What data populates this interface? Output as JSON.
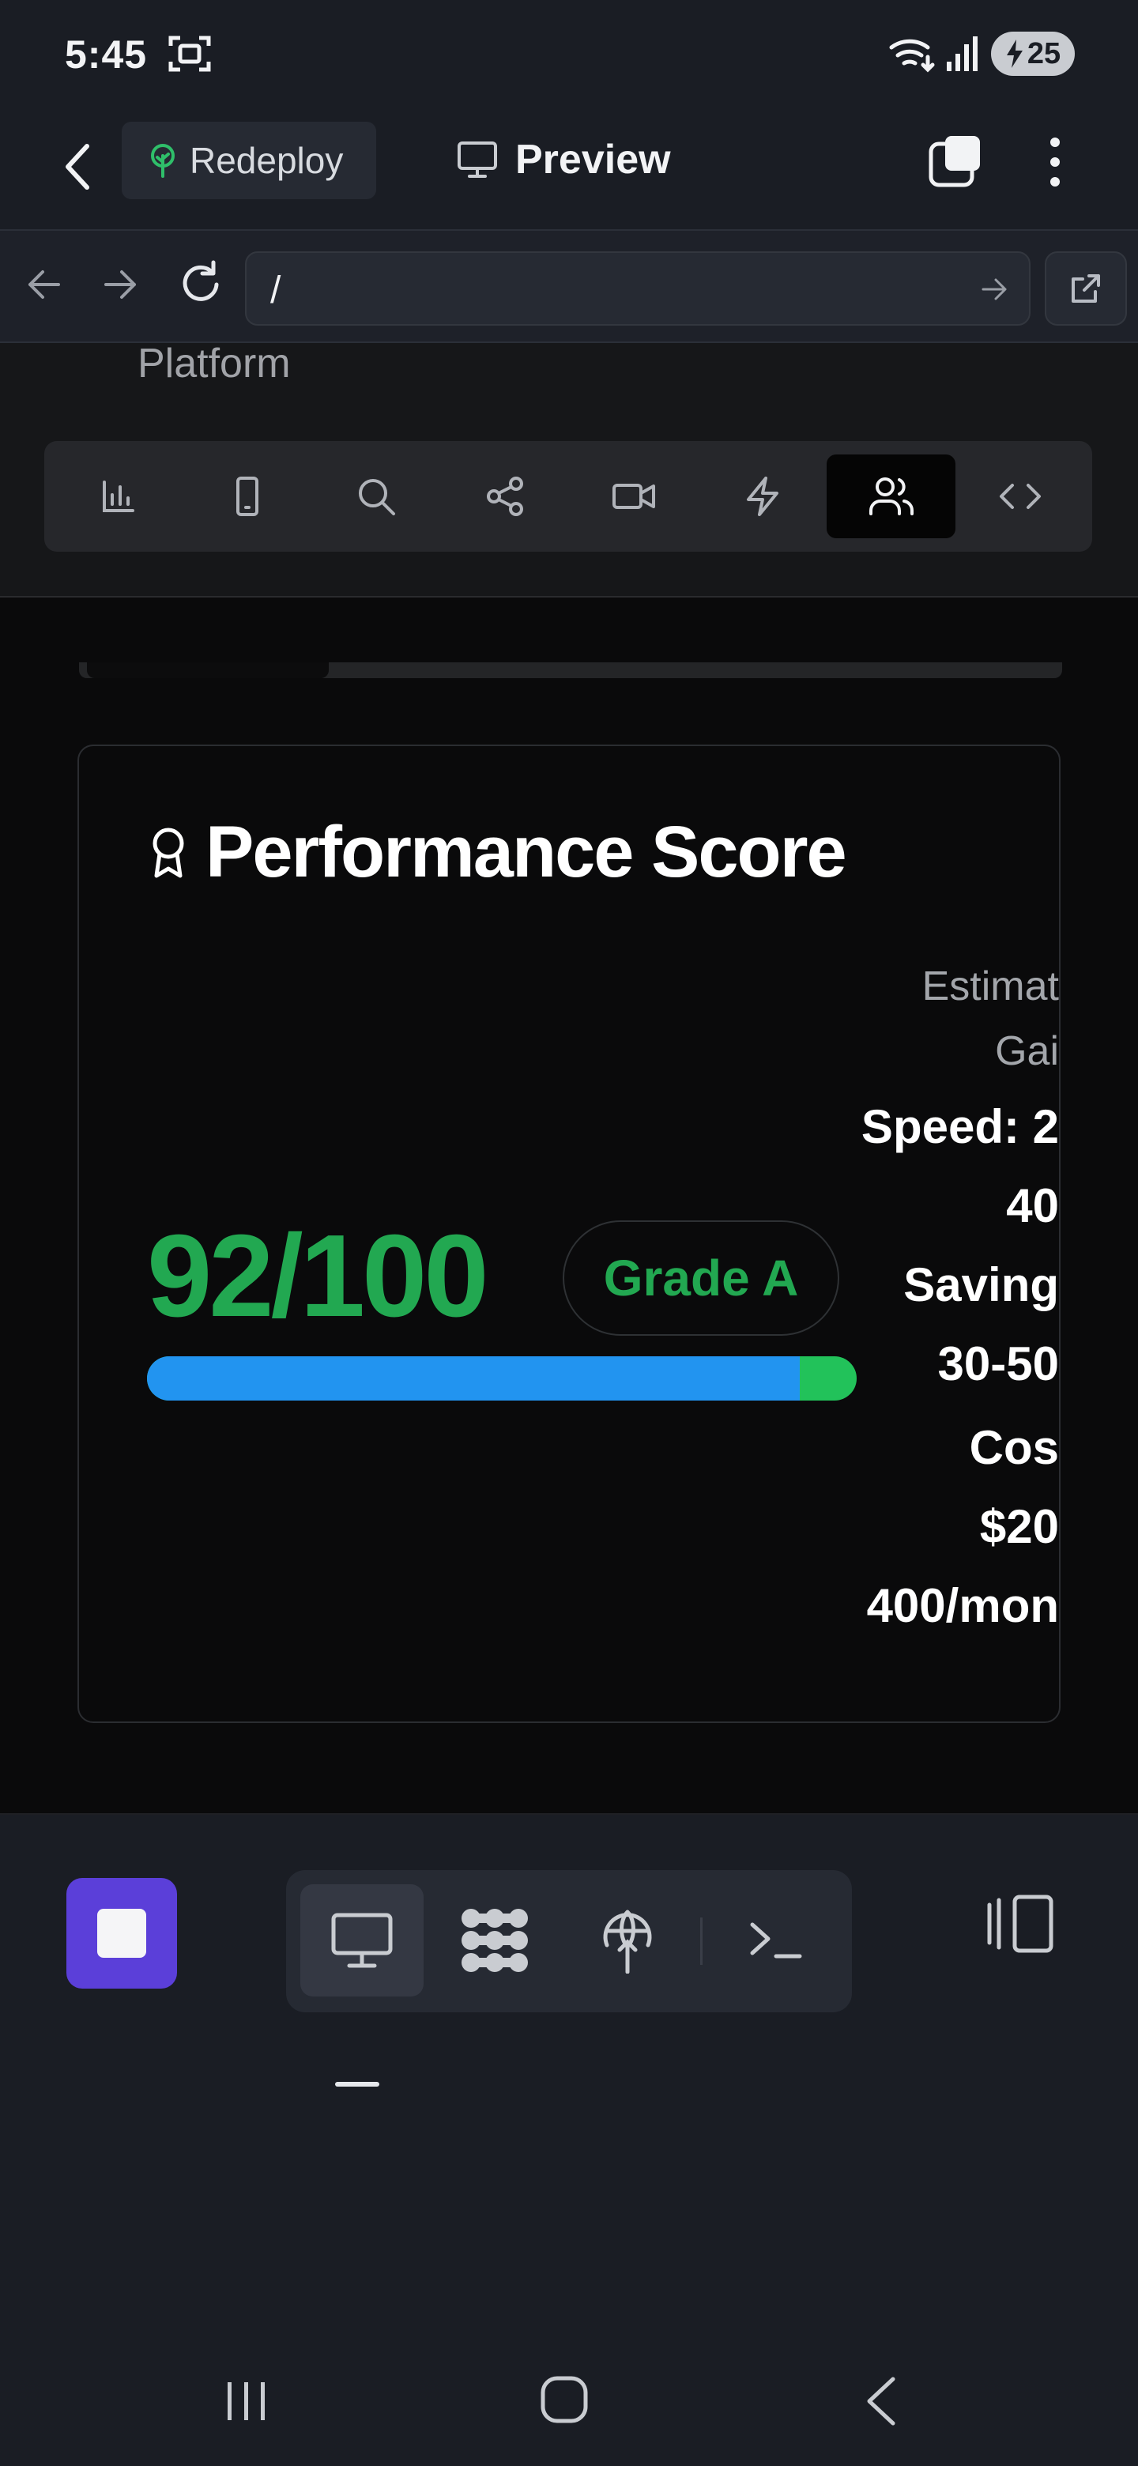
{
  "status_bar": {
    "time": "5:45",
    "battery": "25",
    "icons": [
      "screenshot-icon",
      "wifi-icon",
      "signal-icon",
      "battery-charging-icon"
    ]
  },
  "header": {
    "redeploy_label": "Redeploy",
    "preview_label": "Preview",
    "icons": [
      "chevron-left-icon",
      "tree-icon",
      "monitor-icon",
      "tabs-icon",
      "more-vertical-icon"
    ]
  },
  "url_bar": {
    "url": "/",
    "icons": [
      "arrow-left-icon",
      "arrow-right-icon",
      "reload-icon",
      "arrow-right-small-icon",
      "external-link-icon"
    ]
  },
  "page": {
    "section_label": "Platform",
    "toolbar": [
      {
        "name": "bar-chart-icon",
        "active": false
      },
      {
        "name": "smartphone-icon",
        "active": false
      },
      {
        "name": "search-icon",
        "active": false
      },
      {
        "name": "share-icon",
        "active": false
      },
      {
        "name": "video-icon",
        "active": false
      },
      {
        "name": "zap-icon",
        "active": false
      },
      {
        "name": "users-icon",
        "active": true
      },
      {
        "name": "code-icon",
        "active": false
      }
    ],
    "card": {
      "title": "Performance Score",
      "title_icon": "award-icon",
      "score": "92/100",
      "score_value": 92,
      "grade": "Grade A",
      "progress_fraction": 0.92,
      "gains": {
        "heading_line1": "Estimat",
        "heading_line2": "Gai",
        "speed_line1": "Speed: 2",
        "speed_line2": "40",
        "savings_line1": "Saving",
        "savings_line2": "30-50",
        "cost_line1": "Cos",
        "cost_line2": "$20",
        "cost_line3": "400/mon"
      }
    }
  },
  "bottom_bar": {
    "icons": [
      "stop-icon",
      "monitor-icon",
      "grid-apps-icon",
      "deploy-globe-icon",
      "terminal-icon",
      "panel-toggle-icon"
    ],
    "active_segment": "monitor-icon"
  },
  "system_nav": {
    "icons": [
      "recent-apps-icon",
      "home-icon",
      "back-icon"
    ]
  },
  "colors": {
    "accent_green": "#22a851",
    "progress_blue": "#2294f0",
    "stop_purple": "#5b3fd9"
  }
}
